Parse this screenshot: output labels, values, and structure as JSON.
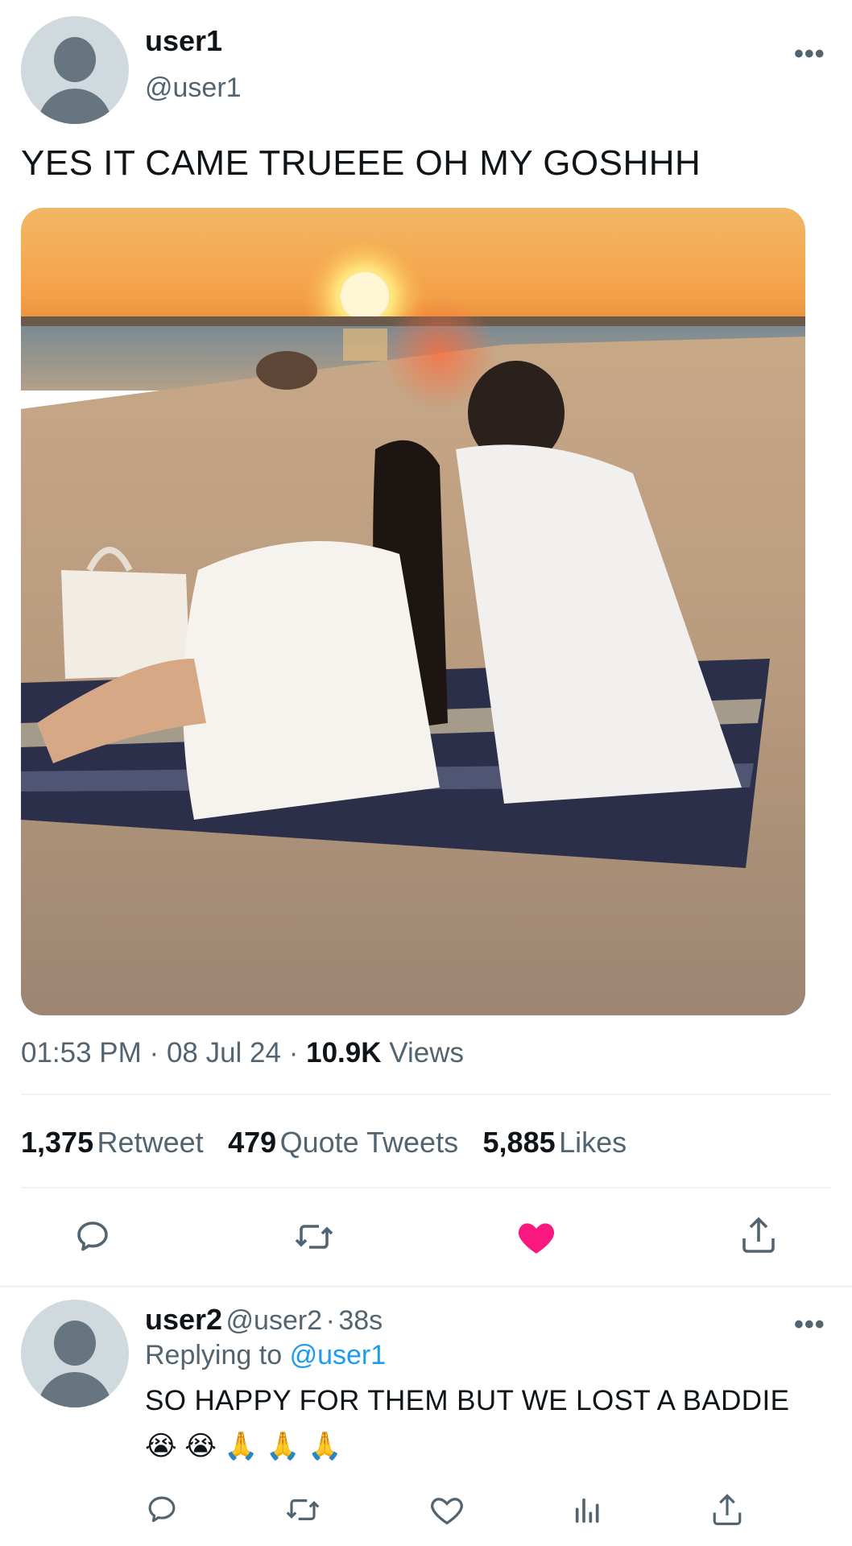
{
  "tweet": {
    "author_name": "user1",
    "author_handle": "@user1",
    "text": "YES IT CAME TRUEEE OH MY GOSHHH",
    "time": "01:53 PM",
    "date": "08 Jul 24",
    "views_count": "10.9K",
    "views_label": "Views",
    "separator": "·",
    "more_label": "•••"
  },
  "stats": {
    "retweets_count": "1,375",
    "retweets_label": "Retweet",
    "quotes_count": "479",
    "quotes_label": "Quote Tweets",
    "likes_count": "5,885",
    "likes_label": "Likes"
  },
  "actions": {
    "like_color": "#f91880",
    "icon_color": "#536471",
    "icons": [
      "reply-icon",
      "retweet-icon",
      "like-icon",
      "share-icon"
    ]
  },
  "reply": {
    "author_name": "user2",
    "author_handle": "@user2",
    "separator": "·",
    "age": "38s",
    "replying_prefix": "Replying to",
    "replying_handle": "@user1",
    "text": "SO HAPPY FOR THEM BUT WE LOST A BADDIE",
    "emojis": [
      "😭",
      "😭",
      "🙏",
      "🙏",
      "🙏"
    ],
    "more_label": "•••",
    "icons": [
      "reply-icon",
      "retweet-icon",
      "like-icon",
      "analytics-icon",
      "share-icon"
    ]
  },
  "colors": {
    "accent": "#1d9bf0",
    "muted": "#536471",
    "like": "#f91880",
    "divider": "#eff3f4"
  }
}
